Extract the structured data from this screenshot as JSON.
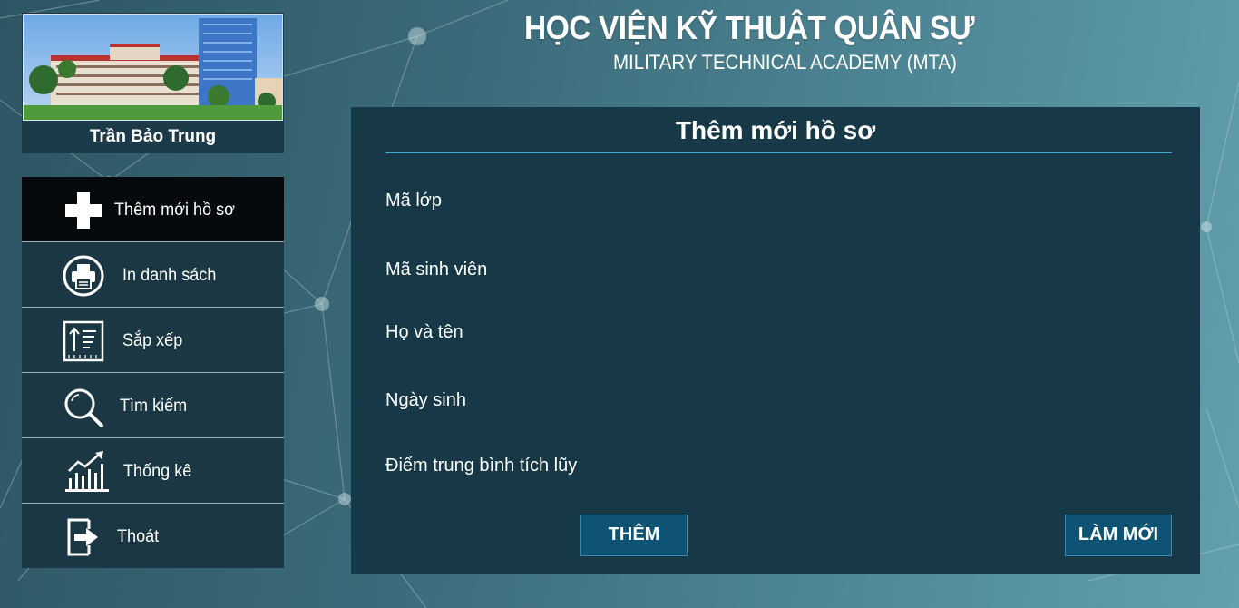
{
  "header": {
    "title": "HỌC VIỆN KỸ THUẬT QUÂN SỰ",
    "subtitle": "MILITARY TECHNICAL ACADEMY (MTA)"
  },
  "profile": {
    "name": "Trần Bảo Trung"
  },
  "menu": {
    "items": [
      {
        "label": "Thêm mới hồ sơ",
        "icon": "plus-icon",
        "active": true
      },
      {
        "label": "In danh sách",
        "icon": "printer-icon"
      },
      {
        "label": "Sắp xếp",
        "icon": "sort-icon"
      },
      {
        "label": "Tìm kiếm",
        "icon": "search-icon"
      },
      {
        "label": "Thống kê",
        "icon": "chart-icon"
      },
      {
        "label": "Thoát",
        "icon": "logout-icon"
      }
    ]
  },
  "form": {
    "title": "Thêm mới hồ sơ",
    "fields": [
      {
        "label": "Mã lớp"
      },
      {
        "label": "Mã sinh viên"
      },
      {
        "label": "Họ và tên"
      },
      {
        "label": "Ngày sinh"
      },
      {
        "label": "Điểm trung bình tích lũy"
      }
    ],
    "add_button": "THÊM",
    "reset_button": "LÀM MỚI"
  },
  "colors": {
    "panel": "#173947",
    "menu": "#1c3744",
    "menu_active": "#060a0d",
    "button": "#0f5374",
    "accent_line": "#3fa8d6"
  }
}
